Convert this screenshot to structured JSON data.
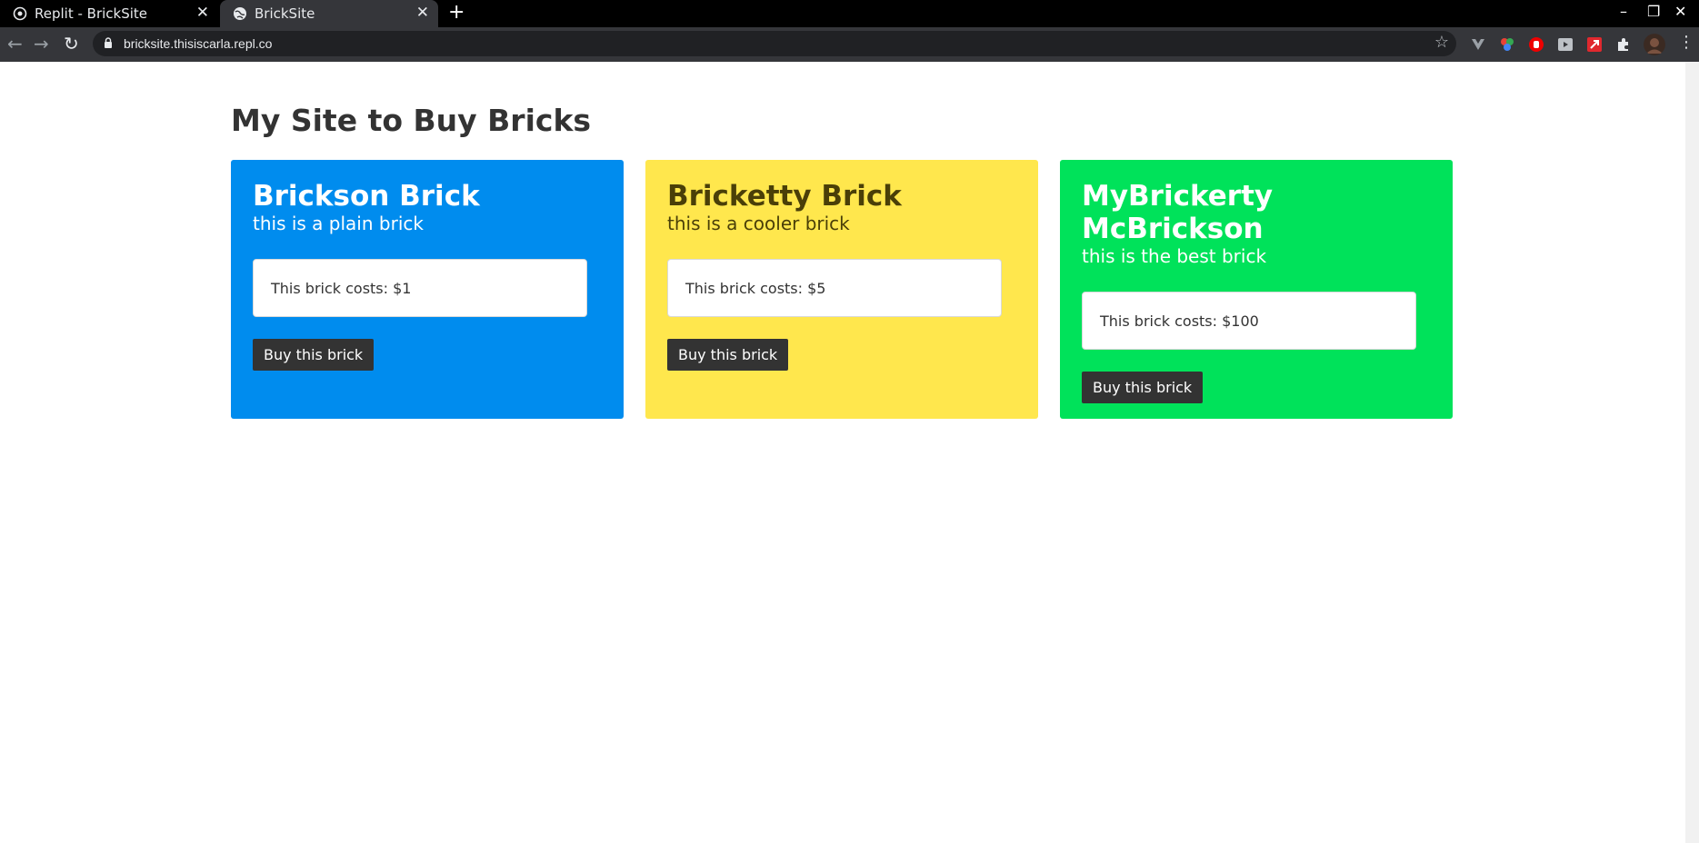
{
  "browser": {
    "tabs": [
      {
        "title": "Replit - BrickSite",
        "icon": "replit-icon",
        "active": false
      },
      {
        "title": "BrickSite",
        "icon": "globe-icon",
        "active": true
      }
    ],
    "url": "bricksite.thisiscarla.repl.co",
    "extensions": [
      "vuejs-devtools-icon",
      "color-picker-icon",
      "ublock-icon",
      "video-icon",
      "arrow-extension-icon",
      "puzzle-icon",
      "profile-avatar"
    ]
  },
  "page": {
    "title": "My Site to Buy Bricks",
    "cards": [
      {
        "name": "Brickson Brick",
        "description": "this is a plain brick",
        "price_text": "This brick costs: $1",
        "button": "Buy this brick",
        "color": "#008cee"
      },
      {
        "name": "Bricketty Brick",
        "description": "this is a cooler brick",
        "price_text": "This brick costs: $5",
        "button": "Buy this brick",
        "color": "#ffe74d"
      },
      {
        "name": "MyBrickerty McBrickson",
        "description": "this is the best brick",
        "price_text": "This brick costs: $100",
        "button": "Buy this brick",
        "color": "#00e25a"
      }
    ]
  }
}
